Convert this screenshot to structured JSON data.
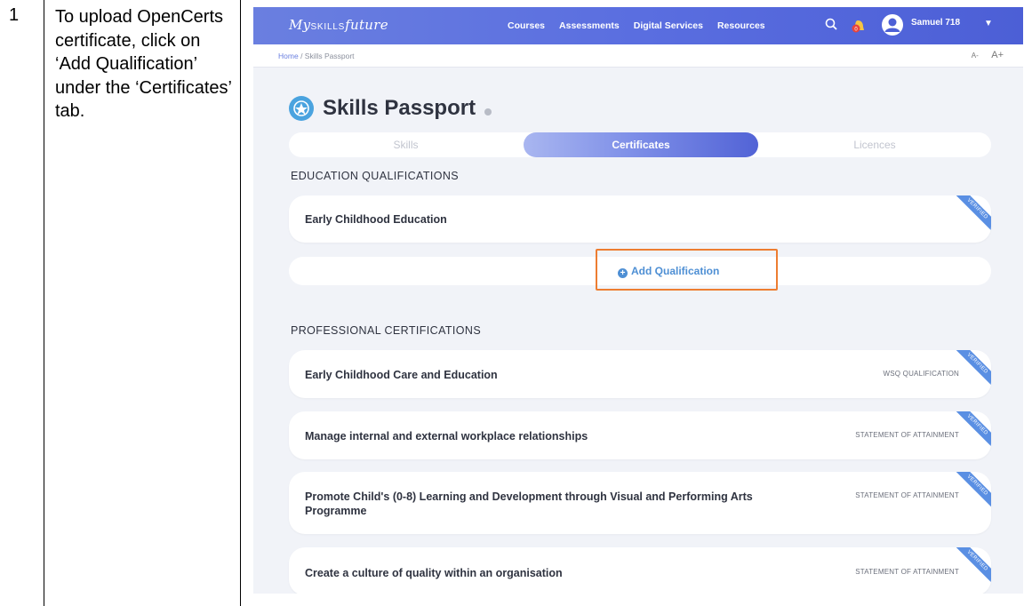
{
  "instruction": {
    "step": "1",
    "text": "To upload OpenCerts certificate, click on ‘Add Qualification’ under the ‘Certificates’ tab."
  },
  "nav": {
    "logo_prefix": "My",
    "logo_caps": "SKILLS",
    "logo_suffix": "future",
    "links": [
      "Courses",
      "Assessments",
      "Digital Services",
      "Resources"
    ],
    "user": "Samuel 718"
  },
  "breadcrumb": {
    "home": "Home",
    "current": "Skills Passport"
  },
  "font_controls": {
    "decrease": "A-",
    "increase": "A+"
  },
  "page": {
    "title": "Skills Passport"
  },
  "tabs": [
    {
      "label": "Skills",
      "active": false
    },
    {
      "label": "Certificates",
      "active": true
    },
    {
      "label": "Licences",
      "active": false
    }
  ],
  "education": {
    "heading": "EDUCATION QUALIFICATIONS",
    "items": [
      {
        "title": "Early Childhood Education",
        "tag": "",
        "ribbon": "VERIFIED"
      }
    ],
    "add_label": "Add Qualification"
  },
  "professional": {
    "heading": "PROFESSIONAL CERTIFICATIONS",
    "items": [
      {
        "title": "Early Childhood Care and Education",
        "tag": "WSQ QUALIFICATION",
        "ribbon": "VERIFIED"
      },
      {
        "title": "Manage internal and external workplace relationships",
        "tag": "STATEMENT OF ATTAINMENT",
        "ribbon": "VERIFIED"
      },
      {
        "title": "Promote Child's (0-8) Learning and Development through Visual and Performing Arts Programme",
        "tag": "STATEMENT OF ATTAINMENT",
        "ribbon": "VERIFIED"
      },
      {
        "title": "Create a culture of quality within an organisation",
        "tag": "STATEMENT OF ATTAINMENT",
        "ribbon": "VERIFIED"
      }
    ]
  },
  "colors": {
    "nav_gradient_start": "#6a7fe0",
    "nav_gradient_end": "#4c5fd6",
    "highlight_box": "#ed7d31",
    "add_link": "#4e8fd4",
    "ribbon": "#5a8fe3"
  }
}
